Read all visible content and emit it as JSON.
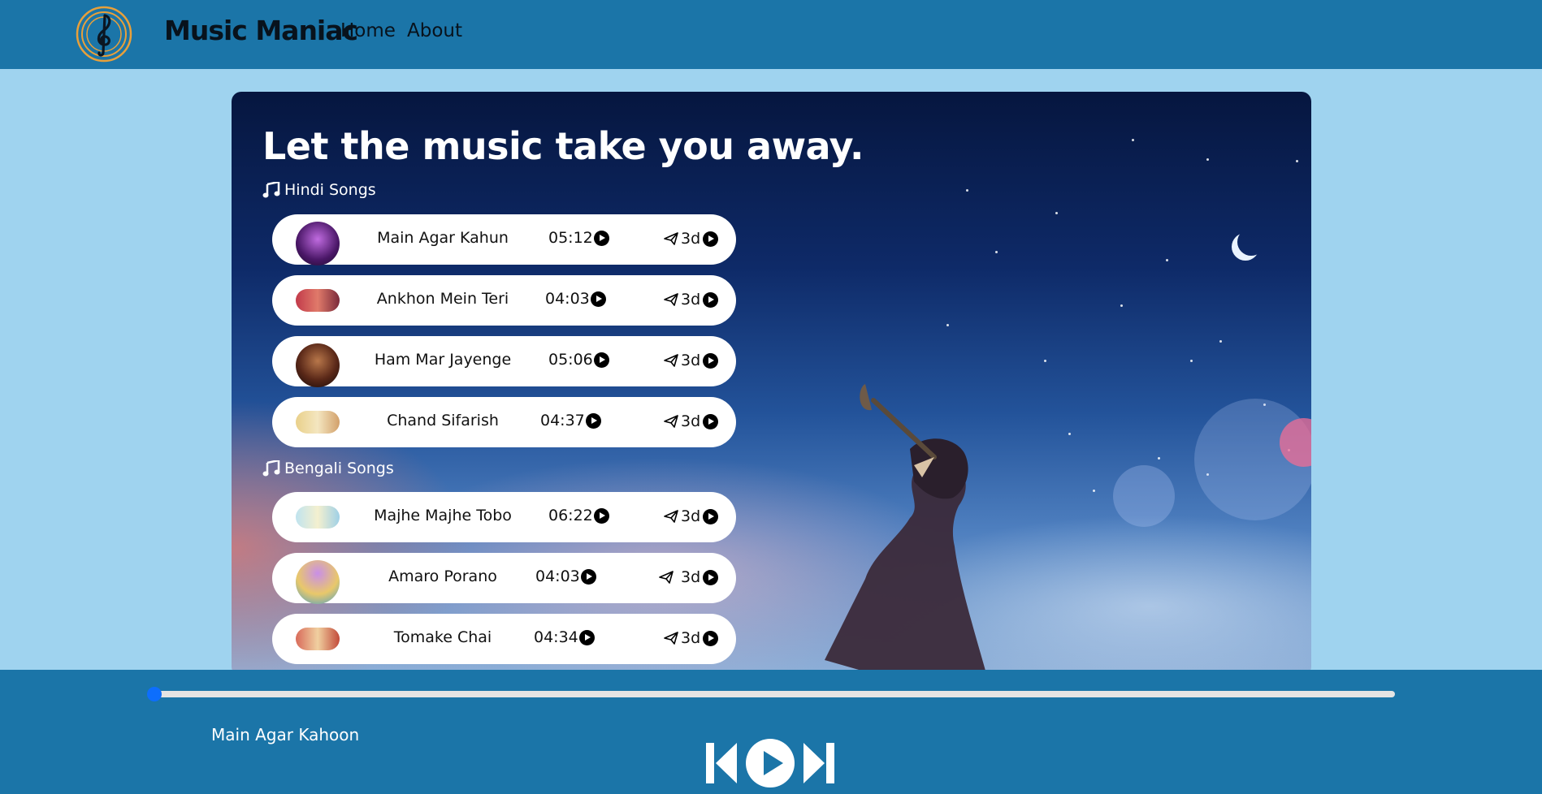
{
  "navbar": {
    "logo_icon": "treble-clef-icon",
    "brand": "Music Maniac",
    "links": [
      "Home",
      "About"
    ]
  },
  "hero": {
    "title": "Let the music take you away.",
    "sections": [
      {
        "label": "Hindi Songs",
        "icon": "music-note-icon",
        "songs": [
          {
            "name": "Main Agar Kahun",
            "duration": "05:12",
            "ago": "3d"
          },
          {
            "name": "Ankhon Mein Teri",
            "duration": "04:03",
            "ago": "3d"
          },
          {
            "name": "Ham Mar Jayenge",
            "duration": "05:06",
            "ago": "3d"
          },
          {
            "name": "Chand Sifarish",
            "duration": "04:37",
            "ago": "3d"
          }
        ]
      },
      {
        "label": "Bengali Songs",
        "icon": "music-note-icon",
        "songs": [
          {
            "name": "Majhe Majhe Tobo",
            "duration": "06:22",
            "ago": "3d"
          },
          {
            "name": "Amaro Porano",
            "duration": "04:03",
            "ago": "3d"
          },
          {
            "name": "Tomake Chai",
            "duration": "04:34",
            "ago": "3d"
          }
        ]
      }
    ]
  },
  "player": {
    "progress": 0,
    "now_playing": "Main Agar Kahoon",
    "controls": [
      "skip-back-icon",
      "play-circle-icon",
      "skip-forward-icon"
    ]
  },
  "colors": {
    "navbar_bg": "#1b75a8",
    "page_bg": "#9fd3ef",
    "progress_thumb": "#0d6efd"
  }
}
